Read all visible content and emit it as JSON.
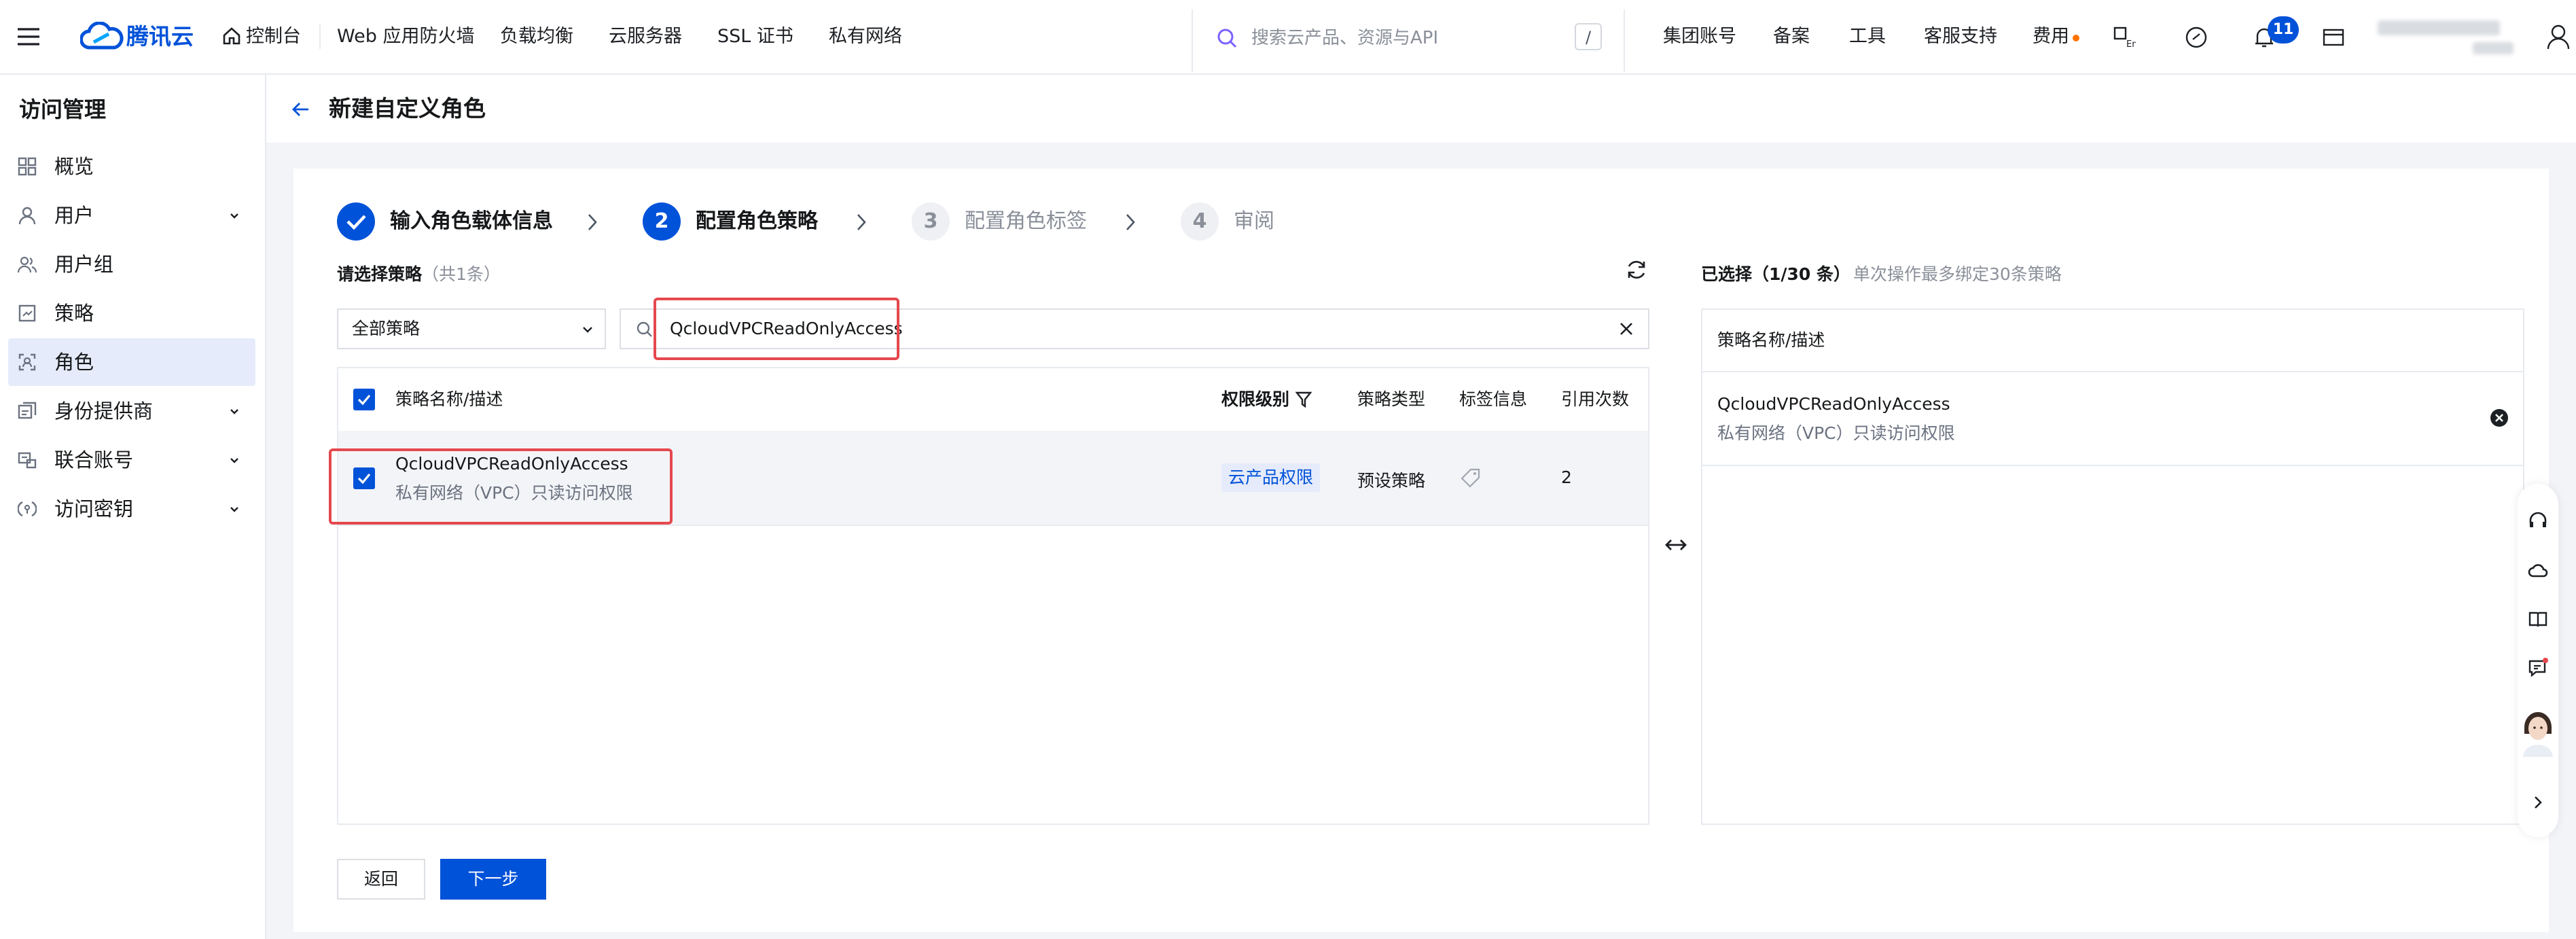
{
  "topbar": {
    "brand": "腾讯云",
    "console": "控制台",
    "nav": [
      "Web 应用防火墙",
      "负载均衡",
      "云服务器",
      "SSL 证书",
      "私有网络"
    ],
    "search_placeholder": "搜索云产品、资源与API",
    "search_shortcut": "/",
    "right_links": [
      "集团账号",
      "备案",
      "工具",
      "客服支持",
      "费用"
    ],
    "notification_count": "11"
  },
  "sidebar": {
    "title": "访问管理",
    "items": [
      {
        "label": "概览",
        "icon": "overview-icon",
        "expandable": false,
        "active": false
      },
      {
        "label": "用户",
        "icon": "user-icon",
        "expandable": true,
        "active": false
      },
      {
        "label": "用户组",
        "icon": "user-group-icon",
        "expandable": false,
        "active": false
      },
      {
        "label": "策略",
        "icon": "policy-icon",
        "expandable": false,
        "active": false
      },
      {
        "label": "角色",
        "icon": "role-icon",
        "expandable": false,
        "active": true
      },
      {
        "label": "身份提供商",
        "icon": "identity-provider-icon",
        "expandable": true,
        "active": false
      },
      {
        "label": "联合账号",
        "icon": "federated-account-icon",
        "expandable": true,
        "active": false
      },
      {
        "label": "访问密钥",
        "icon": "access-key-icon",
        "expandable": true,
        "active": false
      }
    ]
  },
  "page": {
    "title": "新建自定义角色"
  },
  "steps": [
    {
      "number": "1",
      "label": "输入角色载体信息",
      "state": "done"
    },
    {
      "number": "2",
      "label": "配置角色策略",
      "state": "current"
    },
    {
      "number": "3",
      "label": "配置角色标签",
      "state": "pending"
    },
    {
      "number": "4",
      "label": "审阅",
      "state": "pending"
    }
  ],
  "policy_select": {
    "label": "请选择策略",
    "count_text": "（共1条）",
    "filter_value": "全部策略",
    "search_value": "QcloudVPCReadOnlyAccess"
  },
  "table": {
    "headers": {
      "name": "策略名称/描述",
      "level": "权限级别",
      "type": "策略类型",
      "tags": "标签信息",
      "refs": "引用次数"
    },
    "rows": [
      {
        "checked": true,
        "name": "QcloudVPCReadOnlyAccess",
        "desc": "私有网络（VPC）只读访问权限",
        "level": "云产品权限",
        "type": "预设策略",
        "refs": "2"
      }
    ]
  },
  "selected": {
    "label": "已选择",
    "count_text": "（1/30 条）",
    "hint": "单次操作最多绑定30条策略",
    "header": "策略名称/描述",
    "items": [
      {
        "name": "QcloudVPCReadOnlyAccess",
        "desc": "私有网络（VPC）只读访问权限"
      }
    ]
  },
  "buttons": {
    "back": "返回",
    "next": "下一步"
  },
  "colors": {
    "primary": "#0052d9",
    "highlight": "#e5484d",
    "notice_dot": "#ff7200"
  }
}
